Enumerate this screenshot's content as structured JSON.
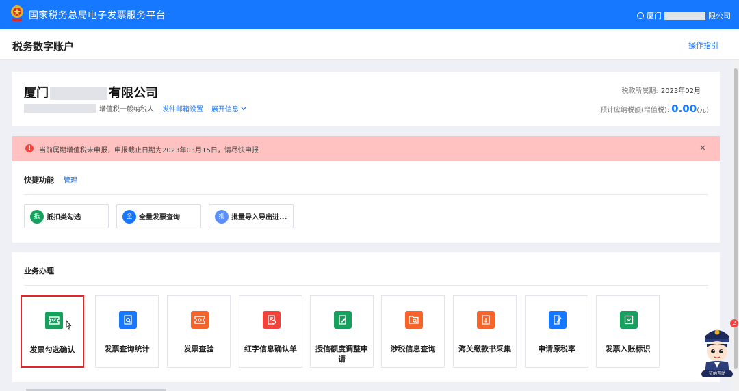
{
  "topbar": {
    "brand": "国家税务总局电子发票服务平台",
    "user_prefix": "厦门",
    "user_suffix": "限公司"
  },
  "header": {
    "title": "税务数字账户",
    "guide": "操作指引"
  },
  "company": {
    "name_prefix": "厦门",
    "name_suffix": "有限公司",
    "taxpayer_type": "增值税一般纳税人",
    "email_link": "发件邮箱设置",
    "expand_link": "展开信息",
    "period_label": "税款所属期:",
    "period_value": "2023年02月",
    "estimate_label": "预计应纳税额(增值税):",
    "estimate_value": "0.00",
    "estimate_unit": "(元)"
  },
  "alert": {
    "icon": "!",
    "message": "当前属期增值税未申报，申报截止日期为2023年03月15日，请尽快申报",
    "close": "×"
  },
  "quick": {
    "title": "快捷功能",
    "manage": "管理",
    "items": [
      {
        "badge": "抵",
        "label": "抵扣类勾选",
        "color": "#17a05d"
      },
      {
        "badge": "全",
        "label": "全量发票查询",
        "color": "#1677ff"
      },
      {
        "badge": "批",
        "label": "批量导入导出进...",
        "color": "#5b8ff9"
      }
    ]
  },
  "business": {
    "title": "业务办理",
    "items": [
      {
        "label": "发票勾选确认",
        "color": "#17a05d",
        "icon": "ticket-icon"
      },
      {
        "label": "发票查询统计",
        "color": "#1677ff",
        "icon": "doc-search-icon"
      },
      {
        "label": "发票查验",
        "color": "#f5642a",
        "icon": "ticket-check-icon"
      },
      {
        "label": "红字信息确认单",
        "color": "#f0443b",
        "icon": "red-doc-icon"
      },
      {
        "label": "授信额度调整申请",
        "color": "#17a05d",
        "icon": "edit-doc-icon"
      },
      {
        "label": "涉税信息查询",
        "color": "#f5642a",
        "icon": "folder-search-icon"
      },
      {
        "label": "海关缴款书采集",
        "color": "#f5642a",
        "icon": "customs-icon"
      },
      {
        "label": "申请原税率",
        "color": "#1677ff",
        "icon": "pen-doc-icon"
      },
      {
        "label": "发票入账标识",
        "color": "#17a05d",
        "icon": "inbox-icon"
      }
    ]
  },
  "assistant": {
    "badge": "2",
    "caption": "征纳互动"
  }
}
